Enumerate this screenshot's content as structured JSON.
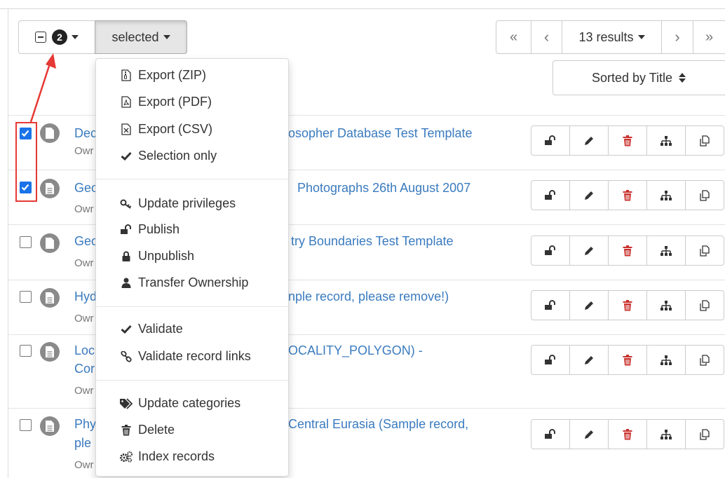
{
  "toolbar": {
    "selected_count": "2",
    "selected_label": "selected",
    "results_label": "13 results",
    "first_page": "«",
    "prev_page": "‹",
    "next_page": "›",
    "last_page": "»",
    "sort_label": "Sorted by Title"
  },
  "menu": {
    "items": [
      {
        "label": "Export (ZIP)",
        "icon": "file-zip-icon"
      },
      {
        "label": "Export (PDF)",
        "icon": "file-pdf-icon"
      },
      {
        "label": "Export (CSV)",
        "icon": "file-csv-icon"
      },
      {
        "label": "Selection only",
        "icon": "check-icon"
      },
      {
        "label": "Update privileges",
        "icon": "key-icon"
      },
      {
        "label": "Publish",
        "icon": "unlock-icon"
      },
      {
        "label": "Unpublish",
        "icon": "lock-icon"
      },
      {
        "label": "Transfer Ownership",
        "icon": "user-icon"
      },
      {
        "label": "Validate",
        "icon": "check-icon"
      },
      {
        "label": "Validate record links",
        "icon": "link-icon"
      },
      {
        "label": "Update categories",
        "icon": "tags-icon"
      },
      {
        "label": "Delete",
        "icon": "trash-icon"
      },
      {
        "label": "Index records",
        "icon": "gears-icon"
      }
    ]
  },
  "records": [
    {
      "title_prefix": "Dec",
      "title_suffix": "osopher Database Test Template",
      "owner": "Owr",
      "checked": true
    },
    {
      "title_prefix": "Geo",
      "title_suffix": "Photographs 26th August 2007",
      "owner": "Owr",
      "checked": true
    },
    {
      "title_prefix": "Geo",
      "title_suffix": "try Boundaries Test Template",
      "owner": "Owr",
      "checked": false
    },
    {
      "title_prefix": "Hyd",
      "title_suffix": "nple record, please remove!)",
      "owner": "Owr",
      "checked": false
    },
    {
      "title_prefix": "Loc",
      "title_line2": "Cor",
      "title_suffix": "OCALITY_POLYGON) -",
      "owner": "Owr",
      "checked": false
    },
    {
      "title_prefix": "Phy",
      "title_line2": "ple",
      "title_suffix": "Central Eurasia (Sample record,",
      "owner": "Owr",
      "checked": false
    }
  ],
  "colors": {
    "link": "#3a7bbf",
    "danger": "#c9302c",
    "annotation": "#e53935",
    "checkbox": "#1a73e8"
  }
}
